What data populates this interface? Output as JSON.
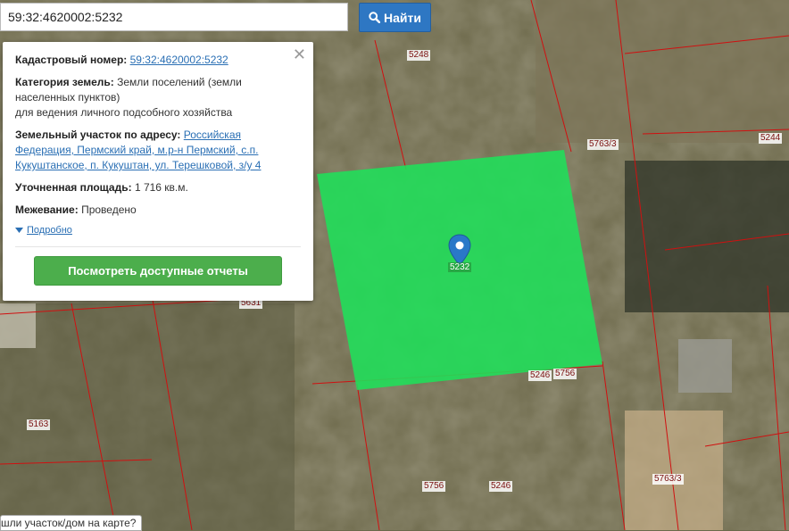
{
  "search": {
    "value": "59:32:4620002:5232",
    "button_label": "Найти"
  },
  "card": {
    "cadastral_label": "Кадастровый номер:",
    "cadastral_value": "59:32:4620002:5232",
    "category_label": "Категория земель:",
    "category_value_1": "Земли поселений (земли населенных пунктов)",
    "category_value_2": "для ведения личного подсобного хозяйства",
    "address_label": "Земельный участок по адресу:",
    "address_value": "Российская Федерация, Пермский край, м.р-н Пермский, с.п. Кукуштанское, п. Кукуштан, ул. Терешковой, з/у 4",
    "area_label": "Уточненная площадь:",
    "area_value": "1 716 кв.м.",
    "survey_label": "Межевание:",
    "survey_value": "Проведено",
    "more_link": "Подробно",
    "report_button": "Посмотреть доступные отчеты"
  },
  "map": {
    "selected_label": "5232",
    "parcel_labels": [
      "5248",
      "5763/3",
      "5244",
      "5631",
      "5246",
      "5756",
      "5163",
      "5756",
      "5246",
      "5763/3"
    ],
    "highlight_color": "#1fe05a",
    "boundary_color": "#d01010"
  },
  "hint_text": "шли участок/дом на карте?"
}
